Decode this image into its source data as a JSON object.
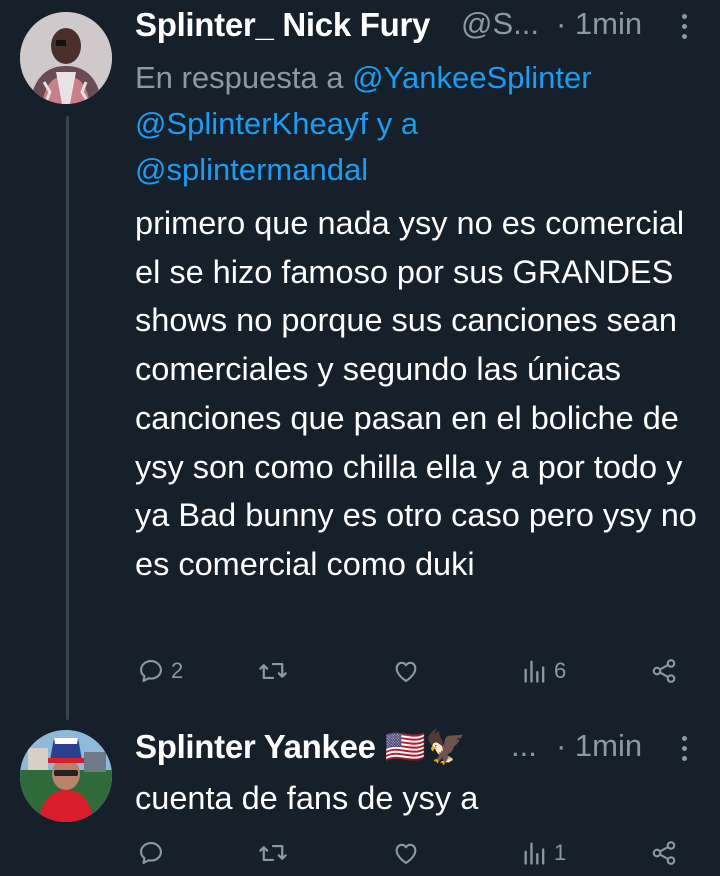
{
  "tweets": [
    {
      "display_name": "Splinter_ Nick Fury",
      "handle": "@S...",
      "time": "· 1min",
      "reply_prefix": "En respuesta a ",
      "mention1": "@YankeeSplinter",
      "mention2": "@SplinterKheayf",
      "reply_and": " y a",
      "mention3": "@splintermandal",
      "text": "primero que nada ysy no es comercial el se hizo famoso por sus GRANDES shows no porque sus canciones sean comerciales y segundo las únicas canciones que pasan en el boliche de ysy son como chilla ella y a por todo y ya Bad bunny es otro caso pero ysy no es comercial como duki",
      "replies": "2",
      "retweets": "",
      "likes": "",
      "views": "6"
    },
    {
      "display_name": "Splinter Yankee 🇺🇸🦅",
      "handle": "...",
      "time": "· 1min",
      "text": "cuenta de fans de ysy a",
      "replies": "",
      "retweets": "",
      "likes": "",
      "views": "1"
    }
  ],
  "icons": {
    "reply": "reply-icon",
    "retweet": "retweet-icon",
    "like": "heart-icon",
    "views": "views-icon",
    "share": "share-icon",
    "more": "more-icon"
  },
  "colors": {
    "background": "#15202b",
    "mention": "#1d9bf0",
    "secondary_text": "#8b98a5",
    "thread_line": "#38444d"
  }
}
